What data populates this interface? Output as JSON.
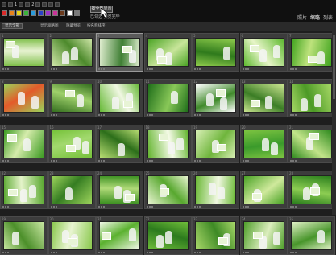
{
  "toolbar": {
    "row1_labels": [
      "1",
      "2"
    ],
    "button_label": "按全部显示",
    "sub_label": "已勾选 预览完毕",
    "swatch_colors": [
      "#d92a2a",
      "#e7821c",
      "#e6d219",
      "#3bb33b",
      "#2a9ad9",
      "#2a42c9",
      "#9b34c9",
      "#c93499",
      "#6c3a1c",
      "#ffffff",
      "#7a7a7a"
    ]
  },
  "view_tabs": {
    "items": [
      "照片",
      "缩略",
      "列表"
    ],
    "active_index": 1
  },
  "secondary_bar": {
    "button_label": "显示全部",
    "links": [
      "显示缩略图",
      "隐藏预览",
      "按名称排序"
    ]
  },
  "grid": {
    "rows": 5,
    "columns": 7,
    "selected_index": 2,
    "cells": [
      {
        "num": "1",
        "palette": [
          "#7fbf4a",
          "#e9f3d3"
        ]
      },
      {
        "num": "2",
        "palette": [
          "#cfe6a8",
          "#4d8a2c"
        ]
      },
      {
        "num": "3",
        "palette": [
          "#e0eed0",
          "#3f7f34"
        ]
      },
      {
        "num": "4",
        "palette": [
          "#49a323",
          "#c8e59a"
        ]
      },
      {
        "num": "5",
        "palette": [
          "#8fcc4c",
          "#2f7a1c"
        ]
      },
      {
        "num": "6",
        "palette": [
          "#5db92e",
          "#e7f5c8"
        ]
      },
      {
        "num": "7",
        "palette": [
          "#3fa31d",
          "#bde27c"
        ]
      },
      {
        "num": "8",
        "palette": [
          "#9ad15a",
          "#e45a2a"
        ]
      },
      {
        "num": "9",
        "palette": [
          "#356f1f",
          "#9fd16b"
        ]
      },
      {
        "num": "10",
        "palette": [
          "#66b936",
          "#f0f7e2"
        ]
      },
      {
        "num": "11",
        "palette": [
          "#1f6e1a",
          "#89c858"
        ]
      },
      {
        "num": "12",
        "palette": [
          "#ffffff",
          "#3f8a2a"
        ]
      },
      {
        "num": "13",
        "palette": [
          "#c9e48f",
          "#3b7d25"
        ]
      },
      {
        "num": "14",
        "palette": [
          "#a6d765",
          "#4c9a26"
        ]
      },
      {
        "num": "15",
        "palette": [
          "#3c9b22",
          "#d6ecac"
        ]
      },
      {
        "num": "16",
        "palette": [
          "#76c23a",
          "#a3d96f"
        ]
      },
      {
        "num": "17",
        "palette": [
          "#b7dc72",
          "#2c6e1a"
        ]
      },
      {
        "num": "18",
        "palette": [
          "#63b42e",
          "#f6fbe8"
        ]
      },
      {
        "num": "19",
        "palette": [
          "#d8efb5",
          "#6fb53c"
        ]
      },
      {
        "num": "20",
        "palette": [
          "#7cc341",
          "#3a9a2b"
        ]
      },
      {
        "num": "21",
        "palette": [
          "#2f8a1e",
          "#c2e48a"
        ]
      },
      {
        "num": "22",
        "palette": [
          "#5aa830",
          "#e4f3c9"
        ]
      },
      {
        "num": "23",
        "palette": [
          "#9bd25b",
          "#357d22"
        ]
      },
      {
        "num": "24",
        "palette": [
          "#3d9122",
          "#b0da78"
        ]
      },
      {
        "num": "25",
        "palette": [
          "#e7f4cf",
          "#58a82f"
        ]
      },
      {
        "num": "26",
        "palette": [
          "#6ab835",
          "#f0f8e1"
        ]
      },
      {
        "num": "27",
        "palette": [
          "#4aa325",
          "#cfe99c"
        ]
      },
      {
        "num": "28",
        "palette": [
          "#2a7e1c",
          "#8ccd52"
        ]
      },
      {
        "num": "29",
        "palette": [
          "#c7e6a0",
          "#4c8f2a"
        ]
      },
      {
        "num": "30",
        "palette": [
          "#8ac84d",
          "#e9f5d2"
        ]
      },
      {
        "num": "31",
        "palette": [
          "#f2f8e8",
          "#5bb12f"
        ]
      },
      {
        "num": "32",
        "palette": [
          "#6fbd3a",
          "#2c7a1d"
        ]
      },
      {
        "num": "33",
        "palette": [
          "#a9d86a",
          "#3e8a25"
        ]
      },
      {
        "num": "34",
        "palette": [
          "#4f9f2a",
          "#dceebe"
        ]
      },
      {
        "num": "35",
        "palette": [
          "#e1f1c6",
          "#47952a"
        ]
      }
    ]
  }
}
